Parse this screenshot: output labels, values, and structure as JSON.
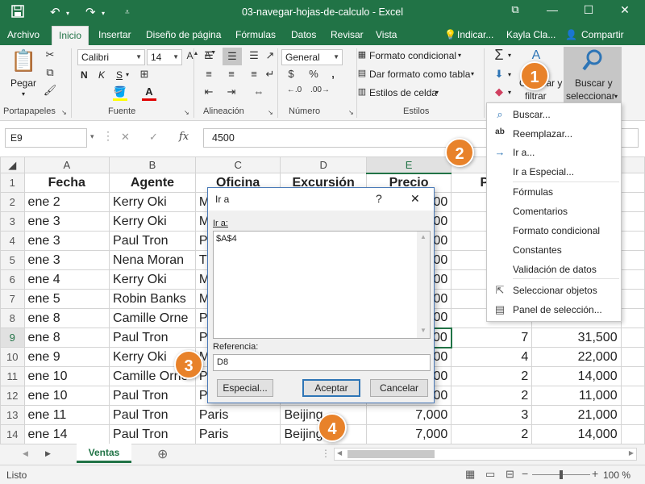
{
  "window": {
    "title": "03-navegar-hojas-de-calculo  -  Excel",
    "controls": [
      "⧉",
      "—",
      "☐",
      "✕"
    ]
  },
  "tabs": [
    "Archivo",
    "Inicio",
    "Insertar",
    "Diseño de página",
    "Fórmulas",
    "Datos",
    "Revisar",
    "Vista"
  ],
  "tab_active": "Inicio",
  "tell_me": "Indicar...",
  "user": "Kayla Cla...",
  "share": "Compartir",
  "ribbon": {
    "paste": "Pegar",
    "font_name": "Calibri",
    "font_size": "14",
    "bold": "N",
    "italic": "K",
    "underline": "S",
    "number_format": "General",
    "cond_format": "Formato condicional",
    "table_format": "Dar formato como tabla",
    "cell_styles": "Estilos de celda",
    "sort_filter_1": "Ordenar y",
    "sort_filter_2": "filtrar",
    "find_select_1": "Buscar y",
    "find_select_2": "seleccionar",
    "groups": {
      "clipboard": "Portapapeles",
      "font": "Fuente",
      "alignment": "Alineación",
      "number": "Número",
      "styles": "Estilos"
    }
  },
  "formula_bar": {
    "name_box": "E9",
    "fx": "fx",
    "value": "4500"
  },
  "sheet": {
    "columns": [
      "A",
      "B",
      "C",
      "D",
      "E",
      "F",
      "G"
    ],
    "header": [
      "Fecha",
      "Agente",
      "Oficina",
      "Excursión",
      "Precio",
      "Pac",
      ""
    ],
    "rows": [
      {
        "n": "2",
        "cells": [
          "ene 2",
          "Kerry Oki",
          "M",
          "",
          "00",
          "",
          ""
        ]
      },
      {
        "n": "3",
        "cells": [
          "ene 3",
          "Kerry Oki",
          "M",
          "",
          "00",
          "",
          ""
        ]
      },
      {
        "n": "4",
        "cells": [
          "ene 3",
          "Paul Tron",
          "P",
          "",
          "00",
          "",
          ""
        ]
      },
      {
        "n": "5",
        "cells": [
          "ene 3",
          "Nena Moran",
          "T",
          "",
          "00",
          "",
          ""
        ]
      },
      {
        "n": "6",
        "cells": [
          "ene 4",
          "Kerry Oki",
          "M",
          "",
          "00",
          "",
          ""
        ]
      },
      {
        "n": "7",
        "cells": [
          "ene 5",
          "Robin Banks",
          "M",
          "",
          "00",
          "",
          ""
        ]
      },
      {
        "n": "8",
        "cells": [
          "ene 8",
          "Camille Orne",
          "P",
          "",
          "00",
          "",
          ""
        ]
      },
      {
        "n": "9",
        "cells": [
          "ene 8",
          "Paul Tron",
          "P",
          "",
          "00",
          "7",
          "31,500"
        ]
      },
      {
        "n": "10",
        "cells": [
          "ene 9",
          "Kerry Oki",
          "M",
          "",
          "00",
          "4",
          "22,000"
        ]
      },
      {
        "n": "11",
        "cells": [
          "ene 10",
          "Camille Orne",
          "P",
          "",
          "00",
          "2",
          "14,000"
        ]
      },
      {
        "n": "12",
        "cells": [
          "ene 10",
          "Paul Tron",
          "P",
          "",
          "00",
          "2",
          "11,000"
        ]
      },
      {
        "n": "13",
        "cells": [
          "ene 11",
          "Paul Tron",
          "Paris",
          "Beijing",
          "7,000",
          "3",
          "21,000"
        ]
      },
      {
        "n": "14",
        "cells": [
          "ene 14",
          "Paul Tron",
          "Paris",
          "Beijing",
          "7,000",
          "2",
          "14,000"
        ]
      }
    ]
  },
  "find_menu": {
    "items": [
      {
        "icon": "⌕",
        "label": "Buscar..."
      },
      {
        "icon": "ab",
        "label": "Reemplazar..."
      },
      {
        "icon": "→",
        "label": "Ir a..."
      },
      {
        "icon": "",
        "label": "Ir a Especial..."
      },
      {
        "icon": "",
        "label": "Fórmulas"
      },
      {
        "icon": "",
        "label": "Comentarios"
      },
      {
        "icon": "",
        "label": "Formato condicional"
      },
      {
        "icon": "",
        "label": "Constantes"
      },
      {
        "icon": "",
        "label": "Validación de datos"
      },
      {
        "icon": "⇱",
        "label": "Seleccionar objetos"
      },
      {
        "icon": "▤",
        "label": "Panel de selección..."
      }
    ]
  },
  "goto_dialog": {
    "title": "Ir a",
    "help": "?",
    "close": "✕",
    "goto_label": "Ir a:",
    "list": [
      "$A$4"
    ],
    "ref_label": "Referencia:",
    "ref_value": "D8",
    "special_btn": "Especial...",
    "ok_btn": "Aceptar",
    "cancel_btn": "Cancelar"
  },
  "callouts": [
    "1",
    "2",
    "3",
    "4"
  ],
  "sheet_tabs": {
    "active": "Ventas",
    "add": "⊕"
  },
  "status": {
    "ready": "Listo",
    "zoom": "100 %",
    "zoom_minus": "−",
    "zoom_plus": "+"
  },
  "colors": {
    "excel_green": "#217346",
    "callout_orange": "#e8822a",
    "dialog_border": "#4a7ab8"
  }
}
